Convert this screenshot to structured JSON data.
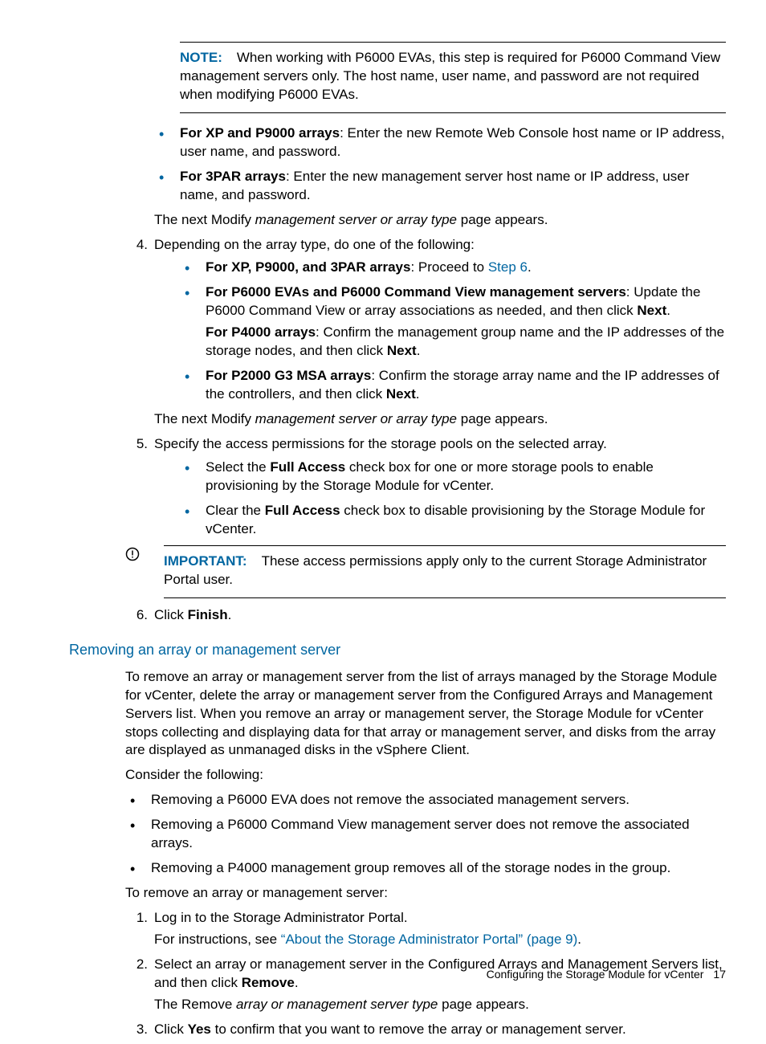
{
  "note": {
    "label": "NOTE:",
    "text": "When working with P6000 EVAs, this step is required for P6000 Command View management servers only. The host name, user name, and password are not required when modifying P6000 EVAs."
  },
  "bullets_top": [
    {
      "bold": "For XP and P9000 arrays",
      "rest": ": Enter the new Remote Web Console host name or IP address, user name, and password."
    },
    {
      "bold": "For 3PAR arrays",
      "rest": ": Enter the new management server host name or IP address, user name, and password."
    }
  ],
  "after_bullets_top": {
    "pre": "The next Modify ",
    "ital": "management server or array type",
    "post": " page appears."
  },
  "step4": {
    "num": "4.",
    "text": "Depending on the array type, do one of the following:",
    "bullets": {
      "b1": {
        "bold": "For XP, P9000, and 3PAR arrays",
        "rest": ": Proceed to ",
        "link": "Step 6",
        "post": "."
      },
      "b2": {
        "line1_bold": "For P6000 EVAs and P6000 Command View management servers",
        "line1_rest": ": Update the P6000 Command View or array associations as needed, and then click ",
        "line1_bold2": "Next",
        "line1_post": ".",
        "line2_bold": "For P4000 arrays",
        "line2_rest": ": Confirm the management group name and the IP addresses of the storage nodes, and then click ",
        "line2_bold2": "Next",
        "line2_post": "."
      },
      "b3": {
        "bold": "For P2000 G3 MSA arrays",
        "rest": ": Confirm the storage array name and the IP addresses of the controllers, and then click ",
        "bold2": "Next",
        "post": "."
      }
    },
    "after": {
      "pre": "The next Modify ",
      "ital": "management server or array type",
      "post": " page appears."
    }
  },
  "step5": {
    "num": "5.",
    "text": "Specify the access permissions for the storage pools on the selected array.",
    "bullets": {
      "b1": {
        "pre": "Select the ",
        "bold": "Full Access",
        "post": " check box for one or more storage pools to enable provisioning by the Storage Module for vCenter."
      },
      "b2": {
        "pre": "Clear the ",
        "bold": "Full Access",
        "post": " check box to disable provisioning by the Storage Module for vCenter."
      }
    }
  },
  "important": {
    "label": "IMPORTANT:",
    "text": "These access permissions apply only to the current Storage Administrator Portal user."
  },
  "step6": {
    "num": "6.",
    "pre": "Click ",
    "bold": "Finish",
    "post": "."
  },
  "heading": "Removing an array or management server",
  "para1": "To remove an array or management server from the list of arrays managed by the Storage Module for vCenter, delete the array or management server from the Configured Arrays and Management Servers list. When you remove an array or management server, the Storage Module for vCenter stops collecting and displaying data for that array or management server, and disks from the array are displayed as unmanaged disks in the vSphere Client.",
  "para2": "Consider the following:",
  "consider_bullets": [
    "Removing a P6000 EVA does not remove the associated management servers.",
    "Removing a P6000 Command View management server does not remove the associated arrays.",
    "Removing a P4000 management group removes all of the storage nodes in the group."
  ],
  "para3": "To remove an array or management server:",
  "remove_steps": {
    "s1": {
      "num": "1.",
      "text": "Log in to the Storage Administrator Portal.",
      "sub_pre": "For instructions, see ",
      "sub_link": "“About the Storage Administrator Portal” (page 9)",
      "sub_post": "."
    },
    "s2": {
      "num": "2.",
      "pre": "Select an array or management server in the Configured Arrays and Management Servers list, and then click ",
      "bold": "Remove",
      "post": ".",
      "sub_pre": "The Remove ",
      "sub_ital": "array or management server type",
      "sub_post": " page appears."
    },
    "s3": {
      "num": "3.",
      "pre": "Click ",
      "bold": "Yes",
      "post": " to confirm that you want to remove the array or management server."
    }
  },
  "footer": {
    "text": "Configuring the Storage Module for vCenter",
    "page": "17"
  }
}
